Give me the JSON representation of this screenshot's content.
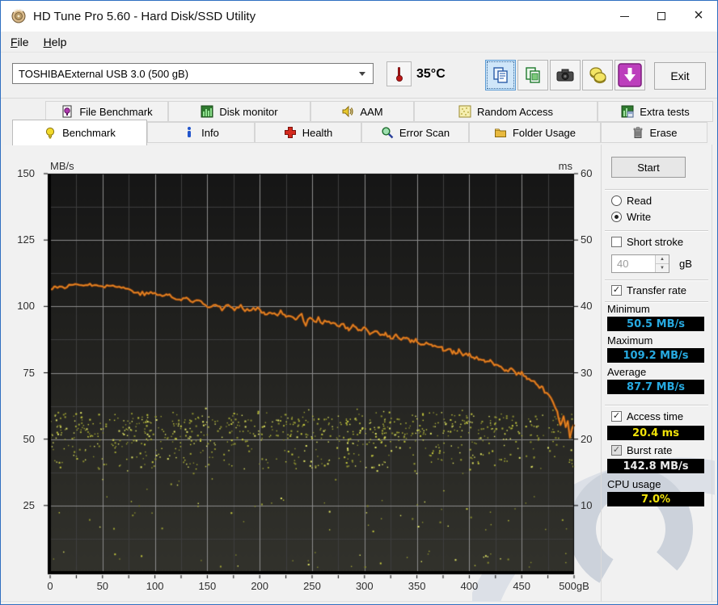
{
  "window": {
    "title": "HD Tune Pro 5.60 - Hard Disk/SSD Utility"
  },
  "menu": {
    "items": [
      {
        "label": "File"
      },
      {
        "label": "Help"
      }
    ]
  },
  "toolbar": {
    "drive_selector": {
      "value": "TOSHIBAExternal USB 3.0 (500 gB)"
    },
    "temperature": {
      "value": "35°C",
      "icon": "thermometer-icon"
    },
    "buttons": [
      {
        "icon": "copy-text-icon",
        "active": true
      },
      {
        "icon": "copy-image-icon",
        "active": false
      },
      {
        "icon": "screenshot-camera-icon",
        "active": false
      },
      {
        "icon": "save-results-icon",
        "active": false
      },
      {
        "icon": "export-download-icon",
        "active": false
      }
    ],
    "exit_label": "Exit"
  },
  "tabs": {
    "row1": [
      {
        "label": "File Benchmark",
        "icon": "file-benchmark-icon"
      },
      {
        "label": "Disk monitor",
        "icon": "disk-monitor-icon"
      },
      {
        "label": "AAM",
        "icon": "speaker-icon"
      },
      {
        "label": "Random Access",
        "icon": "random-access-icon"
      },
      {
        "label": "Extra tests",
        "icon": "extra-tests-icon"
      }
    ],
    "row2": [
      {
        "label": "Benchmark",
        "icon": "lightbulb-icon",
        "active": true
      },
      {
        "label": "Info",
        "icon": "info-icon",
        "active": false
      },
      {
        "label": "Health",
        "icon": "health-cross-icon",
        "active": false
      },
      {
        "label": "Error Scan",
        "icon": "magnifier-icon",
        "active": false
      },
      {
        "label": "Folder Usage",
        "icon": "folder-icon",
        "active": false
      },
      {
        "label": "Erase",
        "icon": "trash-icon",
        "active": false
      }
    ]
  },
  "controls_panel": {
    "start_label": "Start",
    "read": {
      "label": "Read",
      "selected": false
    },
    "write": {
      "label": "Write",
      "selected": true
    },
    "short_stroke": {
      "label": "Short stroke",
      "checked": false
    },
    "capacity": {
      "value": "40",
      "unit": "gB",
      "enabled": false
    },
    "transfer_rate": {
      "label": "Transfer rate",
      "checked": true
    },
    "minimum": {
      "label": "Minimum",
      "value": "50.5 MB/s"
    },
    "maximum": {
      "label": "Maximum",
      "value": "109.2 MB/s"
    },
    "average": {
      "label": "Average",
      "value": "87.7 MB/s"
    },
    "access_time": {
      "label": "Access time",
      "checked": true,
      "value": "20.4 ms"
    },
    "burst_rate": {
      "label": "Burst rate",
      "checked": true,
      "value": "142.8 MB/s"
    },
    "cpu_usage": {
      "label": "CPU usage",
      "value": "7.0%"
    }
  },
  "chart_data": {
    "type": "line+scatter",
    "background": {
      "top": "#161616",
      "bottom": "#32322c"
    },
    "grid": {
      "minor_color": "#3e3e3e",
      "major_color": "#8b8b8b"
    },
    "x_axis": {
      "label_suffix": "gB",
      "min": 0,
      "max": 500,
      "major_step": 50,
      "minor_step": 25,
      "ticks": [
        {
          "v": 0,
          "label": "0"
        },
        {
          "v": 50,
          "label": "50"
        },
        {
          "v": 100,
          "label": "100"
        },
        {
          "v": 150,
          "label": "150"
        },
        {
          "v": 200,
          "label": "200"
        },
        {
          "v": 250,
          "label": "250"
        },
        {
          "v": 300,
          "label": "300"
        },
        {
          "v": 350,
          "label": "350"
        },
        {
          "v": 400,
          "label": "400"
        },
        {
          "v": 450,
          "label": "450"
        },
        {
          "v": 500,
          "label": "500gB"
        }
      ]
    },
    "y_left": {
      "label": "MB/s",
      "min": 0,
      "max": 150,
      "major_step": 25,
      "minor_step": 12.5,
      "ticks": [
        150,
        125,
        100,
        75,
        50,
        25
      ]
    },
    "y_right": {
      "label": "ms",
      "min": 0,
      "max": 60,
      "step": 10,
      "ticks": [
        60,
        50,
        40,
        30,
        20,
        10
      ]
    },
    "transfer_rate_series": {
      "name": "transfer rate (write)",
      "unit": "MB/s",
      "color": "#e98a26",
      "under_color": "#a14e10",
      "min": 50.5,
      "max": 109.2,
      "average": 87.7,
      "anchors": [
        [
          0,
          106.5
        ],
        [
          5,
          107.5
        ],
        [
          12,
          107.0
        ],
        [
          20,
          108.0
        ],
        [
          28,
          108.5
        ],
        [
          36,
          108.0
        ],
        [
          44,
          108.3
        ],
        [
          52,
          107.6
        ],
        [
          60,
          107.8
        ],
        [
          68,
          107.2
        ],
        [
          76,
          106.3
        ],
        [
          84,
          105.2
        ],
        [
          92,
          104.6
        ],
        [
          100,
          105.3
        ],
        [
          105,
          103.8
        ],
        [
          112,
          104.6
        ],
        [
          118,
          103.2
        ],
        [
          125,
          102.2
        ],
        [
          130,
          103.3
        ],
        [
          136,
          101.6
        ],
        [
          142,
          102.5
        ],
        [
          148,
          101.2
        ],
        [
          152,
          99.8
        ],
        [
          158,
          101.0
        ],
        [
          164,
          99.2
        ],
        [
          170,
          100.3
        ],
        [
          176,
          98.8
        ],
        [
          182,
          99.8
        ],
        [
          188,
          98.6
        ],
        [
          194,
          99.6
        ],
        [
          200,
          98.9
        ],
        [
          205,
          97.2
        ],
        [
          210,
          98.3
        ],
        [
          215,
          96.6
        ],
        [
          220,
          97.8
        ],
        [
          225,
          95.9
        ],
        [
          230,
          97.0
        ],
        [
          235,
          95.2
        ],
        [
          240,
          96.8
        ],
        [
          244,
          93.2
        ],
        [
          248,
          96.0
        ],
        [
          252,
          94.4
        ],
        [
          256,
          95.3
        ],
        [
          260,
          93.6
        ],
        [
          264,
          94.8
        ],
        [
          268,
          92.9
        ],
        [
          272,
          93.8
        ],
        [
          276,
          92.2
        ],
        [
          280,
          93.1
        ],
        [
          285,
          91.6
        ],
        [
          290,
          92.6
        ],
        [
          295,
          90.8
        ],
        [
          300,
          91.4
        ],
        [
          305,
          89.8
        ],
        [
          310,
          90.6
        ],
        [
          315,
          89.0
        ],
        [
          320,
          89.8
        ],
        [
          325,
          88.2
        ],
        [
          330,
          89.0
        ],
        [
          335,
          87.4
        ],
        [
          340,
          88.3
        ],
        [
          345,
          86.6
        ],
        [
          350,
          87.2
        ],
        [
          355,
          85.7
        ],
        [
          360,
          86.4
        ],
        [
          365,
          84.8
        ],
        [
          370,
          85.4
        ],
        [
          375,
          83.8
        ],
        [
          380,
          84.3
        ],
        [
          385,
          82.6
        ],
        [
          390,
          83.2
        ],
        [
          395,
          81.4
        ],
        [
          400,
          81.8
        ],
        [
          405,
          80.0
        ],
        [
          410,
          80.6
        ],
        [
          415,
          78.8
        ],
        [
          420,
          79.3
        ],
        [
          425,
          77.4
        ],
        [
          430,
          77.9
        ],
        [
          435,
          76.0
        ],
        [
          440,
          76.4
        ],
        [
          445,
          74.6
        ],
        [
          450,
          74.8
        ],
        [
          455,
          72.8
        ],
        [
          460,
          72.6
        ],
        [
          465,
          70.4
        ],
        [
          470,
          69.6
        ],
        [
          474,
          67.0
        ],
        [
          478,
          64.8
        ],
        [
          482,
          61.5
        ],
        [
          485,
          58.5
        ],
        [
          488,
          55.0
        ],
        [
          490,
          57.5
        ],
        [
          492,
          53.5
        ],
        [
          494,
          56.5
        ],
        [
          496,
          50.5
        ],
        [
          498,
          54.0
        ],
        [
          500,
          55.5
        ]
      ],
      "jitter": {
        "seed": 77,
        "amp_early": 1.0,
        "amp_mid": 1.6,
        "amp_tail": 2.4,
        "step_gb": 2
      }
    },
    "access_time_scatter": {
      "name": "access time",
      "unit": "ms",
      "average": 20.4,
      "colors": [
        "#c6ca3e",
        "#9da135",
        "#e3e766",
        "#8a8d2e"
      ],
      "seed": 1337,
      "count": 950,
      "dot_size": 2,
      "distribution": [
        {
          "weight": 0.58,
          "type": "gauss",
          "center_ms": 22.0,
          "sigma_ms": 1.6,
          "clamp": [
            18.5,
            26.0
          ]
        },
        {
          "weight": 0.31,
          "type": "uniform",
          "range_ms": [
            15.5,
            20.5
          ]
        },
        {
          "weight": 0.07,
          "type": "uniform",
          "range_ms": [
            6.0,
            15.5
          ]
        },
        {
          "weight": 0.04,
          "type": "uniform",
          "range_ms": [
            0.6,
            3.2
          ]
        }
      ]
    }
  }
}
